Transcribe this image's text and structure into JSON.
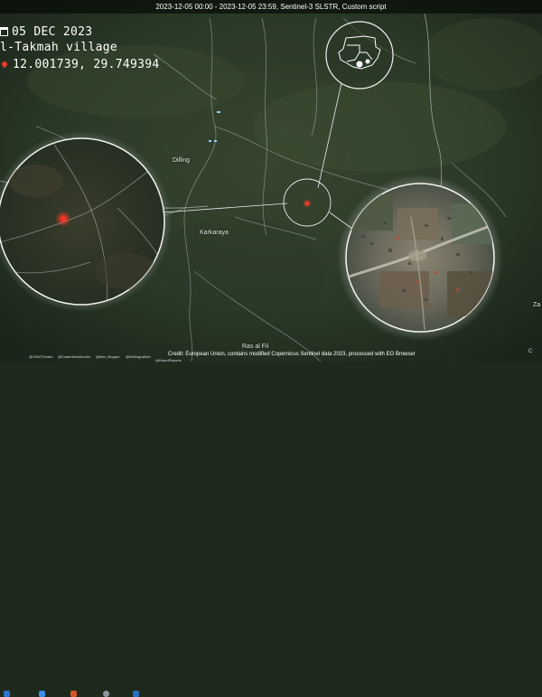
{
  "header": {
    "caption": "2023-12-05 00:00 - 2023-12-05 23:59, Sentinel-3 SLSTR, Custom script"
  },
  "overlay": {
    "date": "05 DEC 2023",
    "location": "l-Takmah village",
    "coordinates": "12.001739, 29.749394"
  },
  "places": {
    "dilling": "Dilling",
    "karkaraya": "Karkaraya",
    "ras_al_fil": "Ras al Fil",
    "edge_label": "Za"
  },
  "icons": {
    "calendar": "calendar-icon",
    "pin": "map-pin-icon",
    "fire": "fire-hotspot-icon",
    "inset_map": "sudan-map-icon"
  },
  "footer": {
    "handles": [
      "@CBNTSudan",
      "@SudanWarMonitor",
      "@Mar_Mapper",
      "@BellingcatNet",
      "@BrandReports"
    ],
    "credit": "Credit: European Union, contains modified Copernicus Sentinel data 2023, processed with EO Browser",
    "logo_text": "C"
  },
  "colors": {
    "hotspot": "#e53d2f",
    "accent_line": "#e6eef5"
  }
}
